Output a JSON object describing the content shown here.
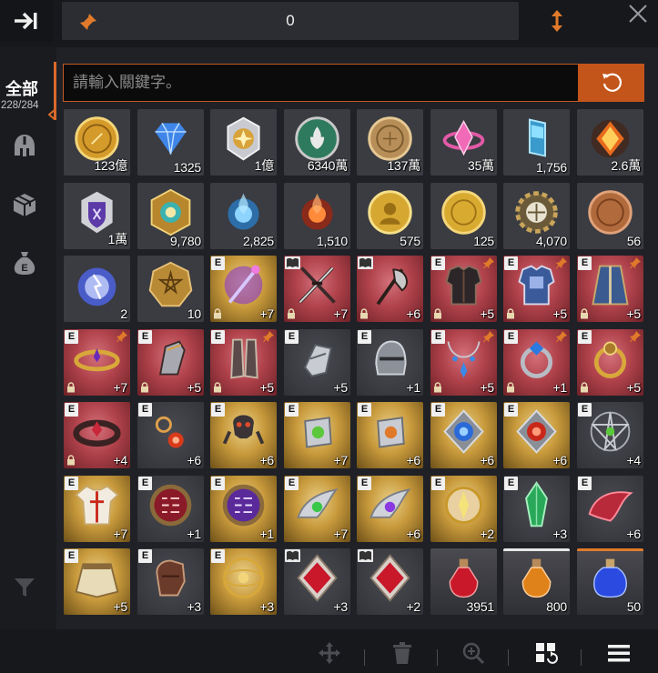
{
  "topbar": {
    "pin_count": "0"
  },
  "sidebar": {
    "all_label": "全部",
    "all_count": "228/284",
    "categories": [
      "helmet-icon",
      "box-icon",
      "money-bag-icon"
    ]
  },
  "search": {
    "placeholder": "請輸入關鍵字。",
    "value": ""
  },
  "colors": {
    "accent": "#c3551b",
    "pin": "#e07a2a",
    "red_slot": "#b0424b",
    "gold_slot": "#c89a3c"
  },
  "items": [
    {
      "name": "gold-coin",
      "qty": "123億",
      "bg": "plain",
      "art": "coin-gold"
    },
    {
      "name": "blue-diamond",
      "qty": "1325",
      "bg": "plain",
      "art": "diamond-blue"
    },
    {
      "name": "silver-medal",
      "qty": "1億",
      "bg": "plain",
      "art": "medal-silver"
    },
    {
      "name": "green-emblem-coin",
      "qty": "6340萬",
      "bg": "plain",
      "art": "coin-green"
    },
    {
      "name": "bronze-coin",
      "qty": "137萬",
      "bg": "plain",
      "art": "coin-bronze"
    },
    {
      "name": "pink-crystal",
      "qty": "35萬",
      "bg": "plain",
      "art": "crystal-pink"
    },
    {
      "name": "blue-gem-prism",
      "qty": "1,756",
      "bg": "plain",
      "art": "prism-blue"
    },
    {
      "name": "rune-crystal",
      "qty": "2.6萬",
      "bg": "plain",
      "art": "rune-orange"
    },
    {
      "name": "purple-shield-medal",
      "qty": "1萬",
      "bg": "plain",
      "art": "medal-purple"
    },
    {
      "name": "ornate-gold-medal",
      "qty": "9,780",
      "bg": "plain",
      "art": "medal-ornate"
    },
    {
      "name": "blue-spirit-orb",
      "qty": "2,825",
      "bg": "plain",
      "art": "orb-blue"
    },
    {
      "name": "red-spirit-orb",
      "qty": "1,510",
      "bg": "plain",
      "art": "orb-red"
    },
    {
      "name": "portrait-gold-coin",
      "qty": "575",
      "bg": "plain",
      "art": "coin-portrait"
    },
    {
      "name": "plain-gold-coin",
      "qty": "125",
      "bg": "plain",
      "art": "coin-plain"
    },
    {
      "name": "gear-medallion",
      "qty": "4,070",
      "bg": "plain",
      "art": "gear"
    },
    {
      "name": "copper-coin",
      "qty": "56",
      "bg": "plain",
      "art": "coin-copper"
    },
    {
      "name": "lightning-orb",
      "qty": "2",
      "bg": "plain",
      "art": "orb-lightning"
    },
    {
      "name": "pentagram-seal",
      "qty": "10",
      "bg": "plain",
      "art": "seal-gold"
    },
    {
      "name": "purple-staff",
      "qty": "+7",
      "bg": "gold",
      "art": "staff",
      "e": true,
      "lock": true
    },
    {
      "name": "crossed-swords",
      "qty": "+7",
      "bg": "red",
      "art": "swords",
      "book": true,
      "lock": true
    },
    {
      "name": "battle-axe",
      "qty": "+6",
      "bg": "red",
      "art": "axe",
      "book": true,
      "lock": true
    },
    {
      "name": "dark-armor",
      "qty": "+5",
      "bg": "red",
      "art": "armor-dark",
      "e": true,
      "pin": true,
      "lock": true
    },
    {
      "name": "blue-plate-armor",
      "qty": "+5",
      "bg": "red",
      "art": "armor-blue",
      "e": true,
      "pin": true,
      "lock": true
    },
    {
      "name": "blue-robe",
      "qty": "+5",
      "bg": "red",
      "art": "robe",
      "e": true,
      "pin": true,
      "lock": true
    },
    {
      "name": "gold-circlet",
      "qty": "+7",
      "bg": "red",
      "art": "circlet",
      "e": true,
      "pin": true,
      "lock": true
    },
    {
      "name": "steel-gauntlets",
      "qty": "+5",
      "bg": "red",
      "art": "gauntlet",
      "e": true,
      "lock": true
    },
    {
      "name": "dark-greaves",
      "qty": "+5",
      "bg": "red",
      "art": "greaves",
      "e": true,
      "pin": true,
      "lock": true
    },
    {
      "name": "silver-gauntlet",
      "qty": "+5",
      "bg": "dark",
      "art": "gauntlet-silver",
      "e": true
    },
    {
      "name": "iron-helm",
      "qty": "+1",
      "bg": "dark",
      "art": "helm",
      "e": true
    },
    {
      "name": "blue-drop-necklace",
      "qty": "+5",
      "bg": "red",
      "art": "necklace",
      "e": true,
      "pin": true,
      "lock": true
    },
    {
      "name": "sapphire-ring",
      "qty": "+1",
      "bg": "red",
      "art": "ring-blue",
      "e": true,
      "pin": true,
      "lock": true
    },
    {
      "name": "gold-ring",
      "qty": "+5",
      "bg": "red",
      "art": "ring-gold",
      "e": true,
      "pin": true,
      "lock": true
    },
    {
      "name": "spiked-collar",
      "qty": "+4",
      "bg": "red",
      "art": "collar",
      "e": true,
      "lock": true
    },
    {
      "name": "ruby-earring",
      "qty": "+6",
      "bg": "dark",
      "art": "earring",
      "e": true
    },
    {
      "name": "demon-skull-charm",
      "qty": "+6",
      "bg": "gold",
      "art": "skull",
      "e": true
    },
    {
      "name": "emerald-bracer",
      "qty": "+7",
      "bg": "gold",
      "art": "bracer-green",
      "e": true
    },
    {
      "name": "amber-bracer",
      "qty": "+6",
      "bg": "gold",
      "art": "bracer-amber",
      "e": true
    },
    {
      "name": "sapphire-amulet",
      "qty": "+6",
      "bg": "gold",
      "art": "amulet-blue",
      "e": true
    },
    {
      "name": "ruby-amulet",
      "qty": "+6",
      "bg": "gold",
      "art": "amulet-red",
      "e": true
    },
    {
      "name": "silver-star-emblem",
      "qty": "+4",
      "bg": "dark",
      "art": "star-emblem",
      "e": true
    },
    {
      "name": "white-tunic",
      "qty": "+7",
      "bg": "gold",
      "art": "tunic",
      "e": true
    },
    {
      "name": "red-rune-tablet",
      "qty": "+1",
      "bg": "dark",
      "art": "tablet-red",
      "e": true
    },
    {
      "name": "purple-rune-tablet",
      "qty": "+1",
      "bg": "gold",
      "art": "tablet-purple",
      "e": true
    },
    {
      "name": "winged-emerald-charm",
      "qty": "+7",
      "bg": "gold",
      "art": "wing-green",
      "e": true
    },
    {
      "name": "winged-amethyst-charm",
      "qty": "+6",
      "bg": "gold",
      "art": "wing-purple",
      "e": true
    },
    {
      "name": "gold-brooch",
      "qty": "+2",
      "bg": "gold",
      "art": "brooch",
      "e": true
    },
    {
      "name": "green-crystal-shard",
      "qty": "+3",
      "bg": "dark",
      "art": "shard-green",
      "e": true
    },
    {
      "name": "crimson-wing",
      "qty": "+6",
      "bg": "dark",
      "art": "wing-red",
      "e": true
    },
    {
      "name": "gilded-belt-skirt",
      "qty": "+5",
      "bg": "gold",
      "art": "skirt",
      "e": true
    },
    {
      "name": "leather-glove",
      "qty": "+3",
      "bg": "dark",
      "art": "glove",
      "e": true
    },
    {
      "name": "golden-orrery",
      "qty": "+3",
      "bg": "gold",
      "art": "orrery",
      "e": true
    },
    {
      "name": "red-diamond-card",
      "qty": "+3",
      "bg": "dark",
      "art": "card-red",
      "book": true
    },
    {
      "name": "red-diamond-card-2",
      "qty": "+2",
      "bg": "dark",
      "art": "card-red",
      "book": true
    },
    {
      "name": "red-potion",
      "qty": "3951",
      "bg": "potion",
      "art": "potion-red"
    },
    {
      "name": "orange-potion",
      "qty": "800",
      "bg": "potion",
      "art": "potion-orange",
      "topline": "white"
    },
    {
      "name": "blue-potion",
      "qty": "50",
      "bg": "potion",
      "art": "potion-blue",
      "topline": "orange"
    }
  ]
}
